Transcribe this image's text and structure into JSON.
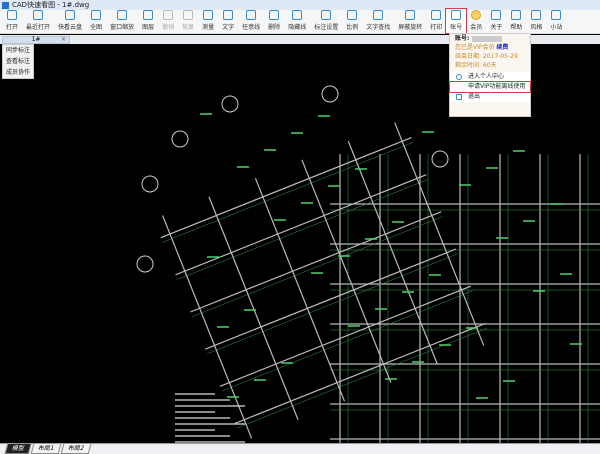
{
  "window": {
    "title": "CAD快速看图 - 1#.dwg"
  },
  "toolbar": [
    {
      "label": "打开",
      "icon": "folder-icon"
    },
    {
      "label": "最近打开",
      "icon": "clock-icon"
    },
    {
      "label": "快看云盘",
      "icon": "cloud-icon"
    },
    {
      "label": "全图",
      "icon": "fullview-icon"
    },
    {
      "label": "窗口缩放",
      "icon": "zoom-window-icon"
    },
    {
      "label": "图层",
      "icon": "layers-icon"
    },
    {
      "label": "撤销",
      "icon": "undo-icon",
      "disabled": true
    },
    {
      "label": "恢复",
      "icon": "redo-icon",
      "disabled": true
    },
    {
      "label": "测量",
      "icon": "measure-icon"
    },
    {
      "label": "文字",
      "icon": "text-icon"
    },
    {
      "label": "任意线",
      "icon": "pen-icon"
    },
    {
      "label": "删除",
      "icon": "eraser-icon"
    },
    {
      "label": "隐藏线",
      "icon": "hide-line-icon"
    },
    {
      "label": "标注设置",
      "icon": "annotation-settings-icon"
    },
    {
      "label": "比例",
      "icon": "scale-icon"
    },
    {
      "label": "文字查找",
      "icon": "text-search-icon"
    },
    {
      "label": "屏蔽旋转",
      "icon": "lock-rotate-icon"
    },
    {
      "label": "打印",
      "icon": "print-icon"
    },
    {
      "label": "账号",
      "icon": "user-icon",
      "active": true
    },
    {
      "label": "会员",
      "icon": "vip-icon",
      "vip": true
    },
    {
      "label": "关于",
      "icon": "info-icon"
    },
    {
      "label": "帮助",
      "icon": "help-icon"
    },
    {
      "label": "风格",
      "icon": "style-icon"
    },
    {
      "label": "小站",
      "icon": "k-icon"
    }
  ],
  "file_tab": {
    "label": "1#",
    "close": "×"
  },
  "left_menu": [
    "同步标注",
    "查看标注",
    "成员协作"
  ],
  "account_menu": {
    "account_label": "账号:",
    "vip_status": "您已是VIP会员",
    "renew_link": "续费",
    "end_date": "结束日期: 2017-05-29",
    "remaining": "剩余时间: 60天",
    "items": [
      {
        "label": "进入个人中心",
        "icon": "user-icon"
      },
      {
        "label": "申请VIP功能离线使用",
        "highlighted": true
      },
      {
        "label": "退出",
        "icon": "logout-icon"
      }
    ]
  },
  "layout_tabs": [
    {
      "label": "模型",
      "active": true
    },
    {
      "label": "布局1"
    },
    {
      "label": "布局2"
    }
  ],
  "colors": {
    "accent": "#2f8fd6",
    "highlight": "#d23b4c",
    "vip": "#c78a2d",
    "canvas": "#000000"
  }
}
